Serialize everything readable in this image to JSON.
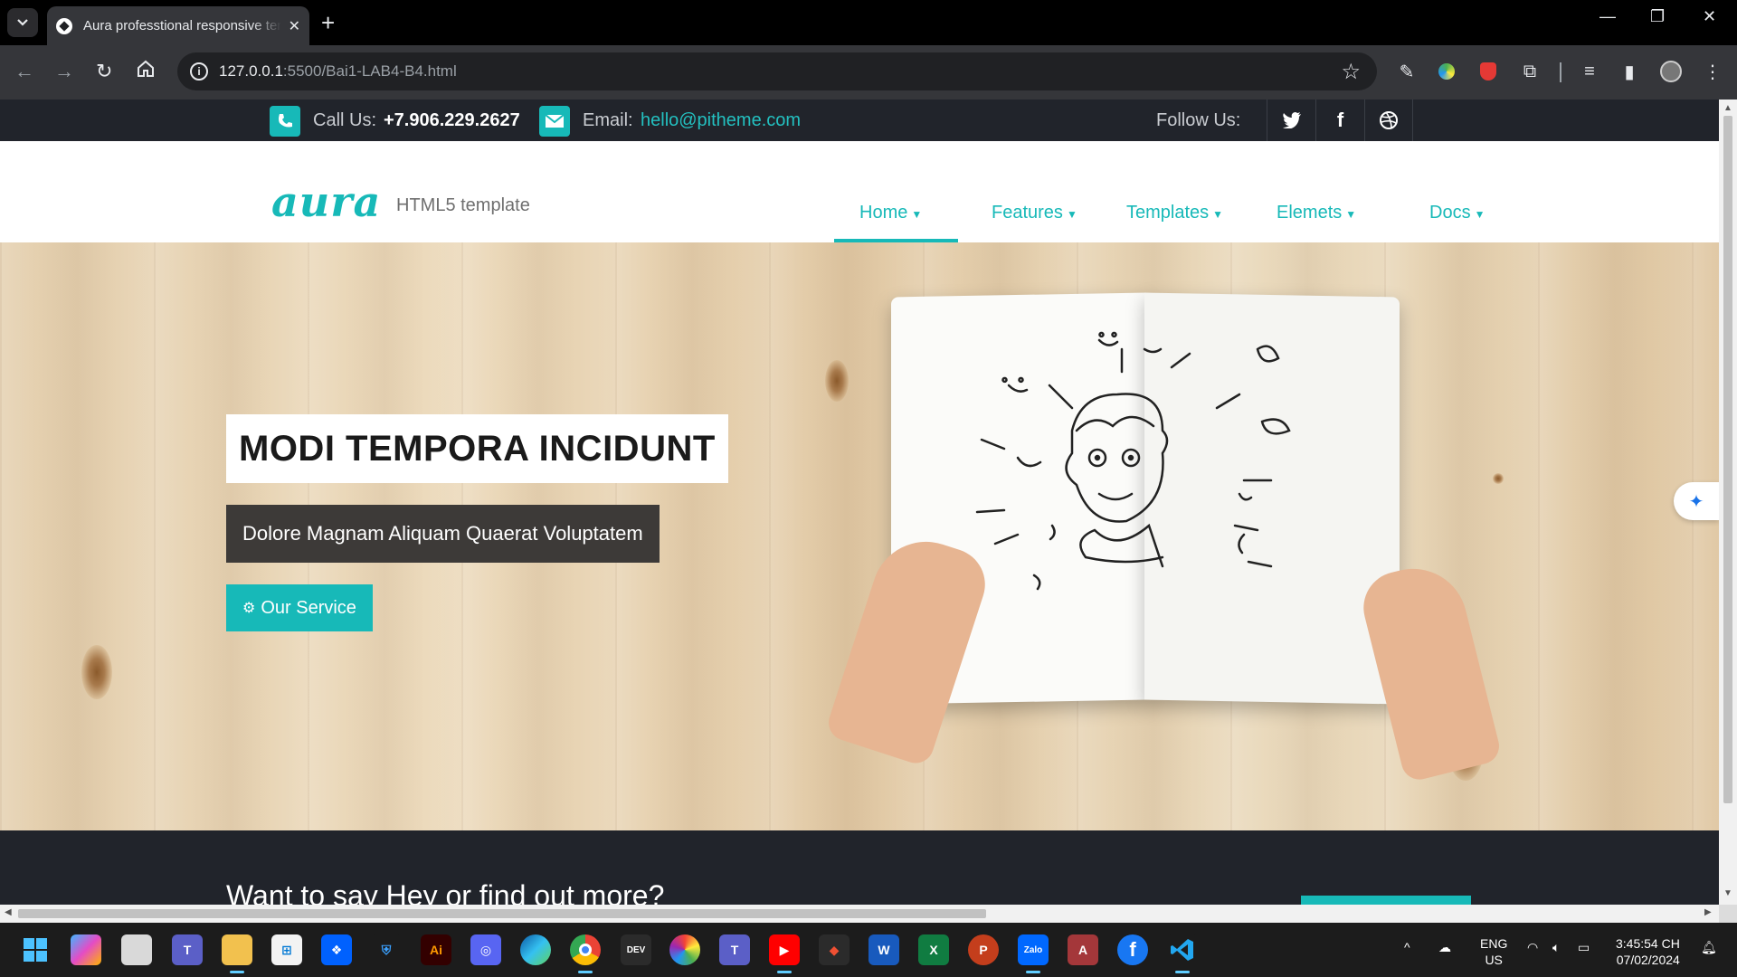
{
  "browser": {
    "tab_title": "Aura professtional responsive template",
    "url_host": "127.0.0.1",
    "url_rest": ":5500/Bai1-LAB4-B4.html"
  },
  "topbar": {
    "call_label": "Call Us:",
    "phone": "+7.906.229.2627",
    "email_label": "Email:",
    "email": "hello@pitheme.com",
    "follow_label": "Follow Us:"
  },
  "header": {
    "logo": "aura",
    "tagline": "HTML5 template",
    "nav": [
      {
        "label": "Home"
      },
      {
        "label": "Features"
      },
      {
        "label": "Templates"
      },
      {
        "label": "Elemets"
      },
      {
        "label": "Docs"
      }
    ],
    "active_nav": "Home"
  },
  "hero": {
    "title": "MODI TEMPORA INCIDUNT",
    "subtitle": "Dolore Magnam Aliquam Quaerat Voluptatem",
    "button": "Our Service"
  },
  "band": {
    "question": "Want to say Hey or find out more?"
  },
  "tray": {
    "lang_top": "ENG",
    "lang_bottom": "US",
    "time": "3:45:54 CH",
    "date": "07/02/2024"
  },
  "colors": {
    "accent": "#17b9b8",
    "topbar_bg": "#21242b",
    "subtitle_bg": "#3d3a38"
  },
  "icons": [
    "phone-icon",
    "envelope-icon",
    "twitter-icon",
    "facebook-icon",
    "dribbble-icon",
    "gear-icon",
    "caret-down-icon"
  ]
}
